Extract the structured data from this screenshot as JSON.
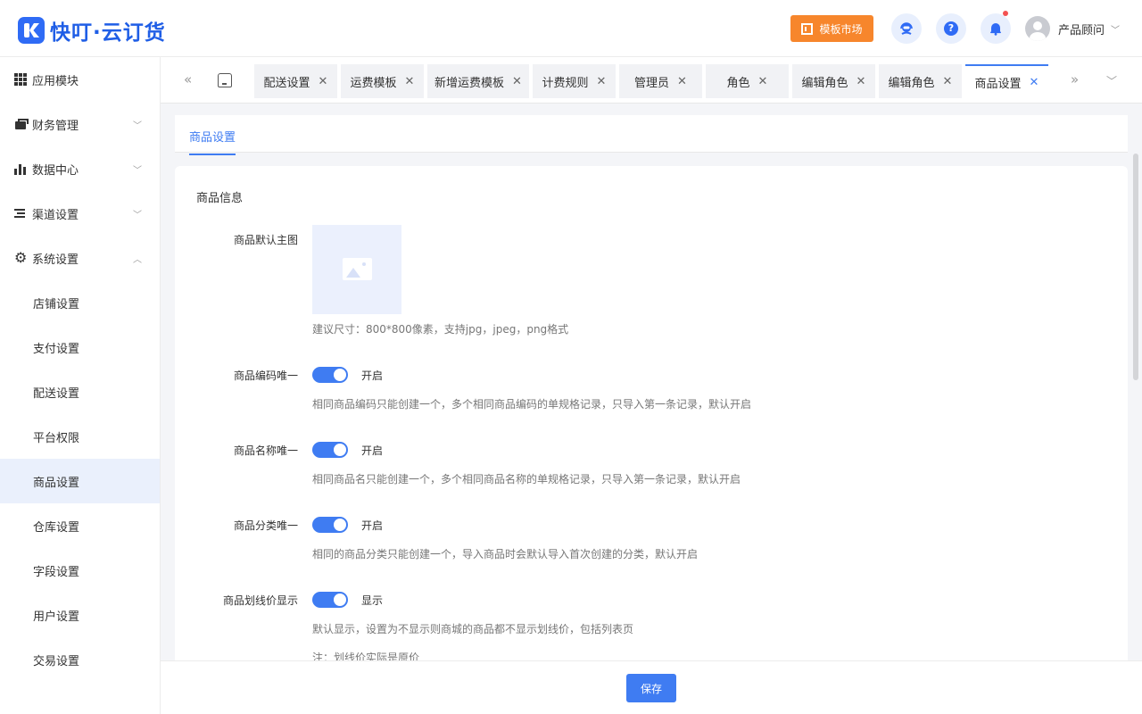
{
  "brand": {
    "logo_text": "快叮·云订货"
  },
  "header": {
    "market_label": "模板市场",
    "user_name": "产品顾问"
  },
  "sidebar": {
    "items": [
      {
        "label": "应用模块",
        "icon": "grid-icon"
      },
      {
        "label": "财务管理",
        "icon": "wallet-icon"
      },
      {
        "label": "数据中心",
        "icon": "bar-chart-icon"
      },
      {
        "label": "渠道设置",
        "icon": "list-icon"
      },
      {
        "label": "系统设置",
        "icon": "gear-icon"
      }
    ],
    "sub_items": [
      {
        "label": "店铺设置"
      },
      {
        "label": "支付设置"
      },
      {
        "label": "配送设置"
      },
      {
        "label": "平台权限"
      },
      {
        "label": "商品设置",
        "active": true
      },
      {
        "label": "仓库设置"
      },
      {
        "label": "字段设置"
      },
      {
        "label": "用户设置"
      },
      {
        "label": "交易设置"
      }
    ]
  },
  "tabs": [
    {
      "label": "配送设置"
    },
    {
      "label": "运费模板"
    },
    {
      "label": "新增运费模板"
    },
    {
      "label": "计费规则"
    },
    {
      "label": "管理员"
    },
    {
      "label": "角色"
    },
    {
      "label": "编辑角色"
    },
    {
      "label": "编辑角色"
    },
    {
      "label": "商品设置",
      "active": true
    }
  ],
  "subtab": {
    "label": "商品设置"
  },
  "section": {
    "title": "商品信息"
  },
  "fields": {
    "main_image": {
      "label": "商品默认主图",
      "hint": "建议尺寸：800*800像素，支持jpg，jpeg，png格式"
    },
    "code_unique": {
      "label": "商品编码唯一",
      "state": "开启",
      "enabled": true,
      "hint": "相同商品编码只能创建一个，多个相同商品编码的单规格记录，只导入第一条记录，默认开启"
    },
    "name_unique": {
      "label": "商品名称唯一",
      "state": "开启",
      "enabled": true,
      "hint": "相同商品名只能创建一个，多个相同商品名称的单规格记录，只导入第一条记录，默认开启"
    },
    "category_unique": {
      "label": "商品分类唯一",
      "state": "开启",
      "enabled": true,
      "hint": "相同的商品分类只能创建一个，导入商品时会默认导入首次创建的分类，默认开启"
    },
    "strike_price": {
      "label": "商品划线价显示",
      "state": "显示",
      "enabled": true,
      "hint": "默认显示，设置为不显示则商城的商品都不显示划线价，包括列表页",
      "note": "注：划线价实际是原价"
    }
  },
  "footer": {
    "save_label": "保存"
  },
  "colors": {
    "primary": "#3f7cf2",
    "market": "#f7862c",
    "active_bg": "#eaf0fc"
  }
}
